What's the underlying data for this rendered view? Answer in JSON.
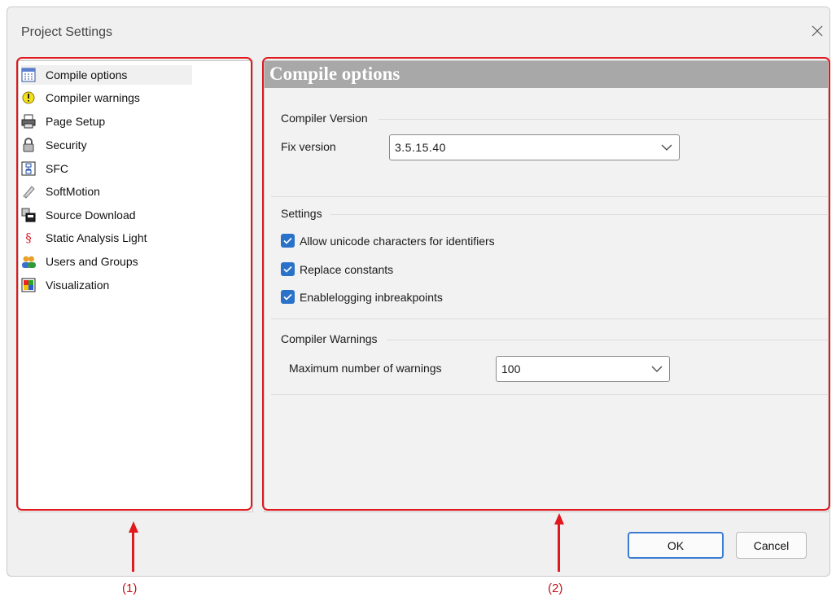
{
  "dialog": {
    "title": "Project Settings"
  },
  "tree": {
    "items": [
      {
        "label": "Compile options",
        "icon": "compile-options-icon",
        "selected": true
      },
      {
        "label": "Compiler warnings",
        "icon": "warning-icon",
        "selected": false
      },
      {
        "label": "Page Setup",
        "icon": "printer-icon",
        "selected": false
      },
      {
        "label": "Security",
        "icon": "lock-icon",
        "selected": false
      },
      {
        "label": "SFC",
        "icon": "sfc-icon",
        "selected": false
      },
      {
        "label": "SoftMotion",
        "icon": "softmotion-icon",
        "selected": false
      },
      {
        "label": "Source Download",
        "icon": "source-download-icon",
        "selected": false
      },
      {
        "label": "Static Analysis Light",
        "icon": "paragraph-icon",
        "selected": false
      },
      {
        "label": "Users and Groups",
        "icon": "users-icon",
        "selected": false
      },
      {
        "label": "Visualization",
        "icon": "visualization-icon",
        "selected": false
      }
    ]
  },
  "content": {
    "header": "Compile options",
    "compiler_version": {
      "group_label": "Compiler Version",
      "fix_version_label": "Fix version",
      "fix_version_value": "3.5.15.40"
    },
    "settings": {
      "group_label": "Settings",
      "checkboxes": [
        {
          "label": "Allow unicode characters for identifiers",
          "checked": true
        },
        {
          "label": "Replace constants",
          "checked": true
        },
        {
          "label": "Enablelogging inbreakpoints",
          "checked": true
        }
      ]
    },
    "compiler_warnings": {
      "group_label": "Compiler Warnings",
      "max_warnings_label": "Maximum number of warnings",
      "max_warnings_value": "100"
    }
  },
  "buttons": {
    "ok": "OK",
    "cancel": "Cancel"
  },
  "annotations": {
    "left": "(1)",
    "right": "(2)"
  },
  "colors": {
    "accent": "#2a72c9",
    "annotation": "#e0191e",
    "header_bg": "#a8a8a8"
  }
}
